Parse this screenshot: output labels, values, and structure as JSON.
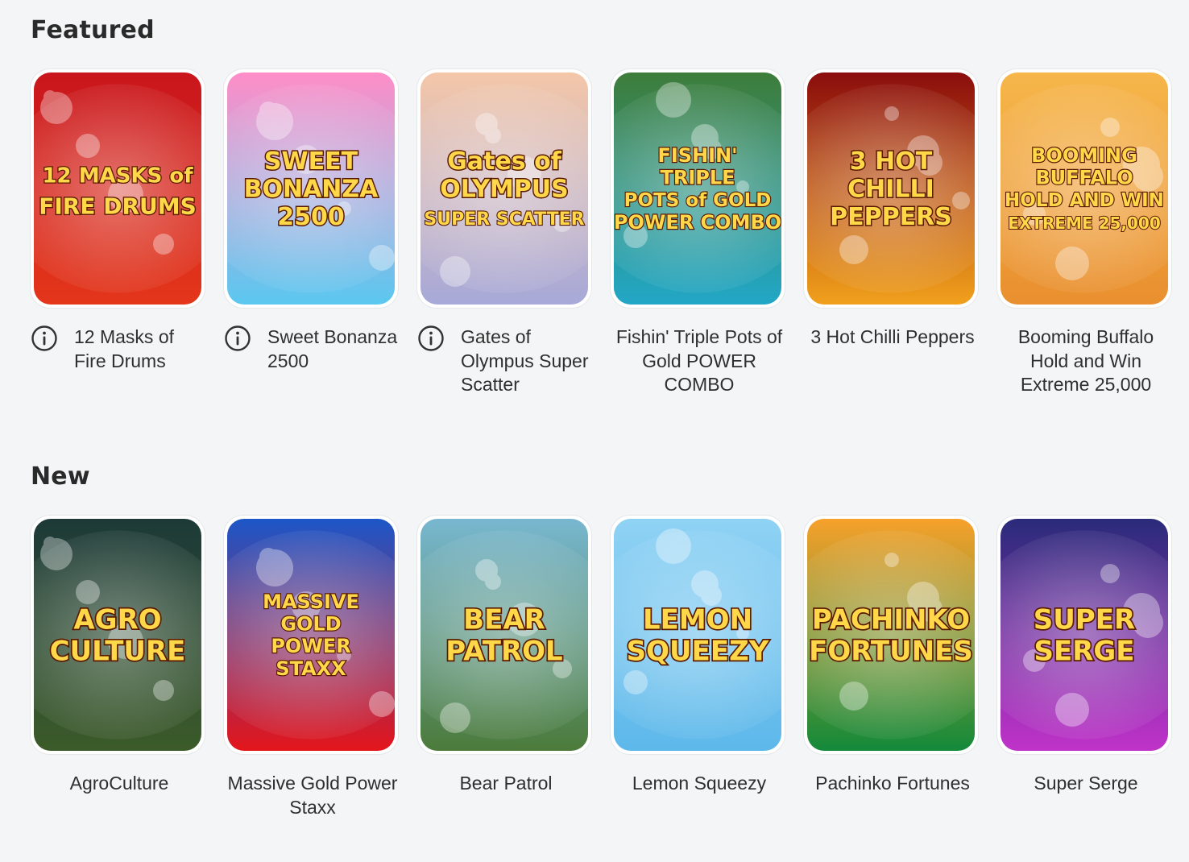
{
  "sections": {
    "featured": {
      "title": "Featured",
      "games": [
        {
          "name": "12 Masks of Fire Drums",
          "logo_lines": [
            "12 MASKS of",
            "FIRE DRUMS"
          ],
          "info": true,
          "colors": [
            "#c9161c",
            "#e3361b"
          ]
        },
        {
          "name": "Sweet Bonanza 2500",
          "logo_lines": [
            "SWEET",
            "BONANZA",
            "2500"
          ],
          "info": true,
          "colors": [
            "#ff8ec8",
            "#5bc8f0"
          ]
        },
        {
          "name": "Gates of Olympus Super Scatter",
          "logo_lines": [
            "Gates of",
            "OLYMPUS",
            "SUPER SCATTER"
          ],
          "info": true,
          "colors": [
            "#f4c7a9",
            "#a7a9d8"
          ]
        },
        {
          "name": "Fishin' Triple Pots of Gold POWER COMBO",
          "logo_lines": [
            "FISHIN'",
            "TRIPLE",
            "POTS of GOLD",
            "POWER COMBO"
          ],
          "info": false,
          "colors": [
            "#3e7d3a",
            "#22a7c7"
          ]
        },
        {
          "name": "3 Hot Chilli Peppers",
          "logo_lines": [
            "3 HOT",
            "CHILLI",
            "PEPPERS"
          ],
          "info": false,
          "colors": [
            "#8b0d0d",
            "#f0a01c"
          ]
        },
        {
          "name": "Booming Buffalo Hold and Win Extreme 25,000",
          "logo_lines": [
            "BOOMING",
            "BUFFALO",
            "HOLD AND WIN",
            "EXTREME 25,000"
          ],
          "info": false,
          "colors": [
            "#f6b64a",
            "#e98f2f"
          ]
        }
      ]
    },
    "new": {
      "title": "New",
      "games": [
        {
          "name": "AgroCulture",
          "logo_lines": [
            "AGRO",
            "CULTURE"
          ],
          "info": false,
          "colors": [
            "#1d3a38",
            "#3c5b2a"
          ]
        },
        {
          "name": "Massive Gold Power Staxx",
          "logo_lines": [
            "MASSIVE",
            "GOLD",
            "POWER",
            "STAXX"
          ],
          "info": false,
          "colors": [
            "#1c56c8",
            "#e4161c"
          ]
        },
        {
          "name": "Bear Patrol",
          "logo_lines": [
            "BEAR",
            "PATROL"
          ],
          "info": false,
          "colors": [
            "#78b7d0",
            "#4c7b3b"
          ]
        },
        {
          "name": "Lemon Squeezy",
          "logo_lines": [
            "LEMON",
            "SQUEEZY"
          ],
          "info": false,
          "colors": [
            "#8fd2f4",
            "#5db8ea"
          ]
        },
        {
          "name": "Pachinko Fortunes",
          "logo_lines": [
            "PACHINKO",
            "FORTUNES"
          ],
          "info": false,
          "colors": [
            "#f7a12b",
            "#138a3a"
          ]
        },
        {
          "name": "Super Serge",
          "logo_lines": [
            "SUPER",
            "SERGE"
          ],
          "info": false,
          "colors": [
            "#2a2b7a",
            "#c033c9"
          ]
        }
      ]
    }
  }
}
